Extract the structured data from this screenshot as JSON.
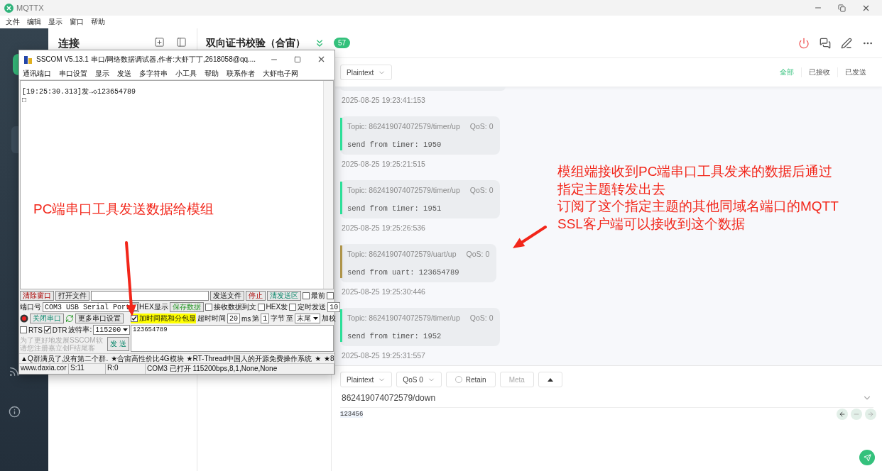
{
  "app": {
    "title": "MQTTX",
    "menu": [
      "文件",
      "编辑",
      "显示",
      "窗口",
      "帮助"
    ]
  },
  "connections": {
    "title": "连接"
  },
  "connection": {
    "name": "双向证书校验（合宙）",
    "count": "57"
  },
  "filter": {
    "format": "Plaintext",
    "tabs": [
      {
        "label": "全部",
        "selected": true
      },
      {
        "label": "已接收",
        "selected": false
      },
      {
        "label": "已发送",
        "selected": false
      }
    ]
  },
  "earlier_timestamp": "2025-08-25 19:23:41:153",
  "messages": [
    {
      "topic": "Topic: 862419074072579/timer/up",
      "qos": "QoS: 0",
      "payload": "send from timer: 1950",
      "time": "2025-08-25 19:25:21:515",
      "color": "#2ee89f"
    },
    {
      "topic": "Topic: 862419074072579/timer/up",
      "qos": "QoS: 0",
      "payload": "send from timer: 1951",
      "time": "2025-08-25 19:25:26:536",
      "color": "#2ee89f"
    },
    {
      "topic": "Topic: 862419074072579/uart/up",
      "qos": "QoS: 0",
      "payload": "send from uart: 123654789",
      "time": "2025-08-25 19:25:30:446",
      "color": "#b59a4c"
    },
    {
      "topic": "Topic: 862419074072579/timer/up",
      "qos": "QoS: 0",
      "payload": "send from timer: 1952",
      "time": "2025-08-25 19:25:31:557",
      "color": "#2ee89f"
    }
  ],
  "publish": {
    "format": "Plaintext",
    "qos": "QoS 0",
    "retain": {
      "label": "Retain",
      "checked": false
    },
    "meta": "Meta",
    "topic": "862419074072579/down",
    "payload": "123456"
  },
  "sscom": {
    "title": "SSCOM V5.13.1 串口/网络数据调试器,作者:大虾丁丁,2618058@qq....",
    "menu": [
      "通讯端口",
      "串口设置",
      "显示",
      "发送",
      "多字符串",
      "小工具",
      "帮助",
      "联系作者",
      "大虾电子网"
    ],
    "receive": [
      "[19:25:30.313]发→◇123654789",
      "□"
    ],
    "clear_button": "清除窗口",
    "open_file": "打开文件",
    "send_file": "发送文件",
    "stop": "停止",
    "clear_send": "清发送区",
    "topmost": {
      "label": "最前",
      "checked": false
    },
    "english": {
      "checked": false
    },
    "port_label": "端口号",
    "port": "COM3 USB Serial Port",
    "hex_display": {
      "label": "HEX显示",
      "checked": false
    },
    "save_data": "保存数据",
    "to_file": {
      "label": "接收数据到文",
      "checked": false
    },
    "hex_send": {
      "label": "HEX发",
      "checked": false
    },
    "timed_send": {
      "label": "定时发送",
      "checked": false
    },
    "interval": "10",
    "close_port": "关闭串口",
    "more_settings": "更多串口设置",
    "timestamp": {
      "label": "加时间戳和分包显",
      "checked": true
    },
    "timeout_label": "超时时间",
    "timeout": "20",
    "ms": "ms",
    "from_label": "第",
    "from": "1",
    "byte_label": "字节",
    "to_label": "至",
    "to": "末尾",
    "checksum": "加校",
    "rts": {
      "label": "RTS",
      "checked": false
    },
    "dtr": {
      "label": "DTR",
      "checked": true
    },
    "baud_label": "波特率:",
    "baud": "115200",
    "hint": [
      "为了更好地发展SSCOM软",
      "请您注册嘉立创F结尾客"
    ],
    "send": "发 送",
    "send_text": "123654789",
    "ticker": [
      "▲Q群满员了,没有第二个群.",
      "★合宙高性价比4G模块",
      "★RT-Thread中国人的开源免费操作系统",
      "★",
      "★8"
    ],
    "status": [
      "www.daxia.cor",
      "S:11",
      "R:0",
      "COM3 已打开  115200bps,8,1,None,None"
    ]
  },
  "annotations": [
    {
      "kind": "label",
      "text": "PC端串口工具发送数据给模组"
    },
    {
      "kind": "note",
      "lines": [
        "模组端接收到PC端串口工具发来的数据后通过",
        "指定主题转发出去",
        "订阅了这个指定主题的其他同域名端口的MQTT",
        "SSL客户端可以接收到这个数据"
      ]
    }
  ]
}
